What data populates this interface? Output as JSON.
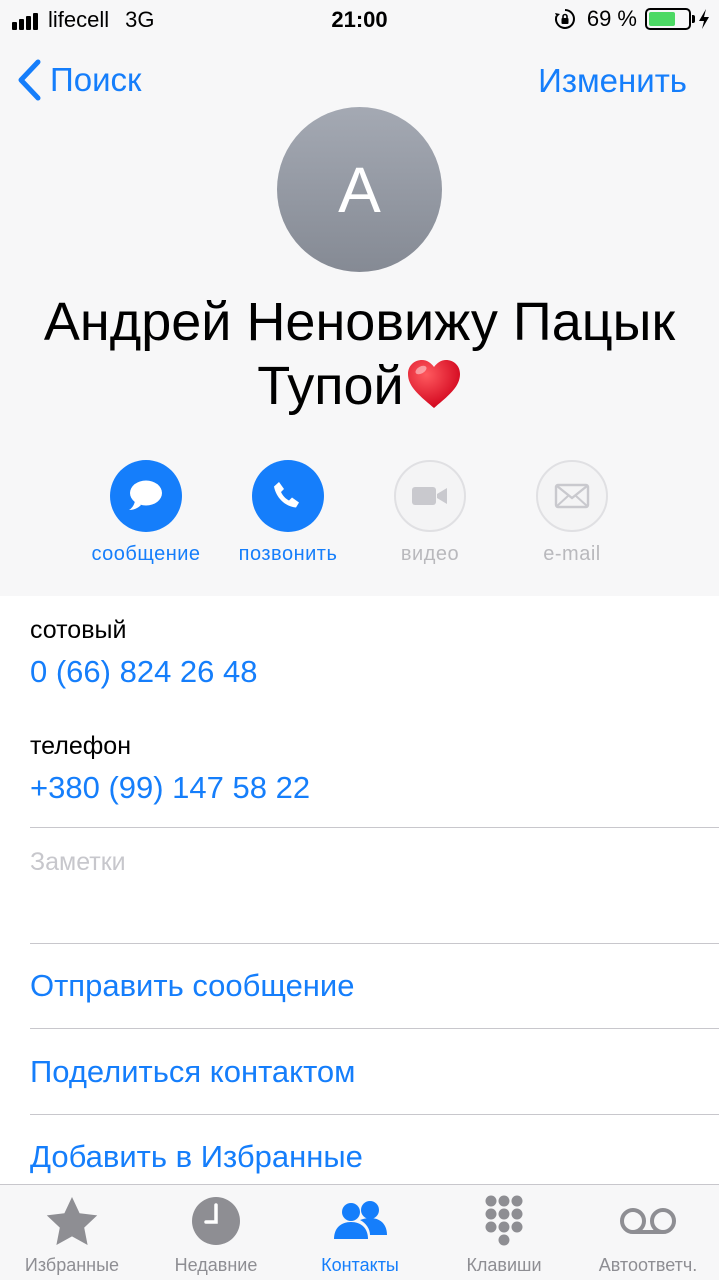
{
  "status_bar": {
    "carrier": "lifecell",
    "network": "3G",
    "time": "21:00",
    "battery_percent": "69 %",
    "battery_level": 0.69,
    "signal_bars": 4
  },
  "nav": {
    "back_label": "Поиск",
    "edit_label": "Изменить"
  },
  "contact": {
    "avatar_initial": "А",
    "name_line1": "Андрей Неновижу Пацык",
    "name_line2": "Тупой"
  },
  "actions": [
    {
      "label": "сообщение",
      "icon": "message-bubble-icon",
      "enabled": true
    },
    {
      "label": "позвонить",
      "icon": "phone-icon",
      "enabled": true
    },
    {
      "label": "видео",
      "icon": "video-camera-icon",
      "enabled": false
    },
    {
      "label": "e-mail",
      "icon": "envelope-icon",
      "enabled": false
    }
  ],
  "phones": [
    {
      "label": "сотовый",
      "number": "0 (66) 824 26 48"
    },
    {
      "label": "телефон",
      "number": "+380 (99) 147 58 22"
    }
  ],
  "notes": {
    "placeholder": "Заметки"
  },
  "links": {
    "send_message": "Отправить сообщение",
    "share_contact": "Поделиться контактом",
    "add_favorites": "Добавить в Избранные"
  },
  "tabs": [
    {
      "label": "Избранные",
      "icon": "star-icon",
      "active": false
    },
    {
      "label": "Недавние",
      "icon": "clock-icon",
      "active": false
    },
    {
      "label": "Контакты",
      "icon": "contacts-icon",
      "active": true
    },
    {
      "label": "Клавиши",
      "icon": "keypad-icon",
      "active": false
    },
    {
      "label": "Автоответч.",
      "icon": "voicemail-icon",
      "active": false
    }
  ],
  "colors": {
    "accent": "#157efb",
    "header_bg": "#f7f7f8",
    "battery_fill": "#4cd964"
  }
}
